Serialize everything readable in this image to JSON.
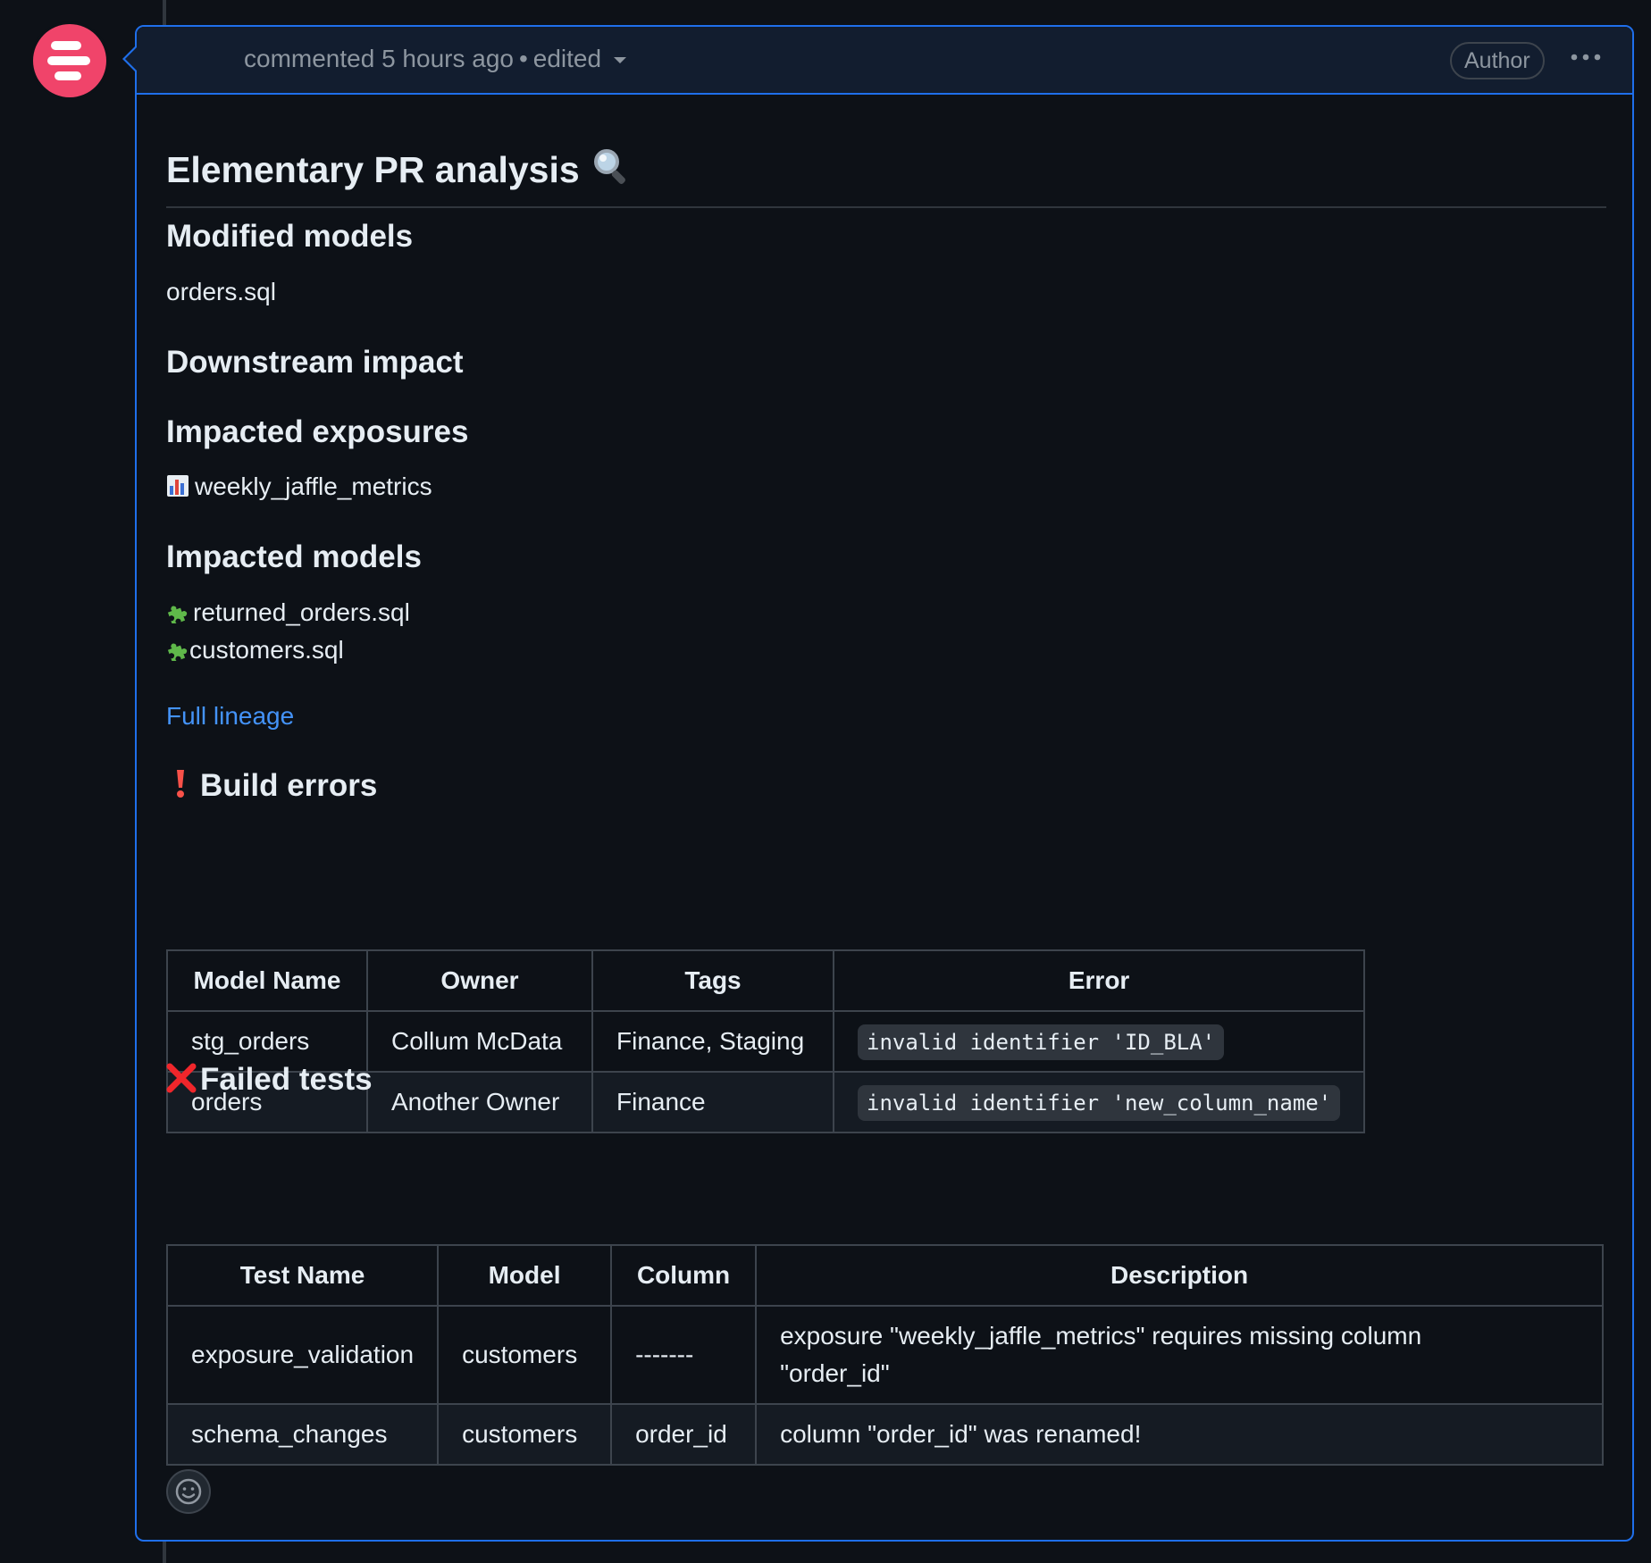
{
  "header": {
    "commented": "commented 5 hours ago",
    "edited": "edited",
    "author_badge": "Author"
  },
  "comment": {
    "title": "Elementary PR analysis",
    "modified_heading": "Modified models",
    "modified_file": "orders.sql",
    "downstream_heading": "Downstream impact",
    "exposures_heading": "Impacted exposures",
    "exposures": [
      "weekly_jaffle_metrics"
    ],
    "models_heading": "Impacted models",
    "impacted_models": [
      "returned_orders.sql",
      "customers.sql"
    ],
    "lineage_link": "Full lineage",
    "build_errors_heading": "Build errors",
    "build_errors": {
      "columns": [
        "Model Name",
        "Owner",
        "Tags",
        "Error"
      ],
      "rows": [
        [
          "stg_orders",
          "Collum McData",
          "Finance, Staging",
          "invalid identifier 'ID_BLA'"
        ],
        [
          "orders",
          "Another Owner",
          "Finance",
          "invalid identifier 'new_column_name'"
        ]
      ]
    },
    "failed_tests_heading": "Failed tests",
    "failed_tests": {
      "columns": [
        "Test Name",
        "Model",
        "Column",
        "Description"
      ],
      "rows": [
        [
          "exposure_validation",
          "customers",
          "-------",
          "exposure \"weekly_jaffle_metrics\" requires missing column",
          "\"order_id\""
        ],
        [
          "schema_changes",
          "customers",
          "order_id",
          "column \"order_id\" was renamed!"
        ]
      ]
    }
  },
  "icons": {
    "title_icon": "magnifier-icon",
    "exposure_icon": "bar-chart-icon",
    "model_icon": "puzzle-icon",
    "build_error_icon": "exclamation-icon",
    "failed_tests_icon": "cross-icon",
    "reaction_icon": "smiley-icon"
  },
  "colors": {
    "background": "#0d1117",
    "accent_border": "#1f6feb",
    "link": "#4493f8",
    "avatar": "#f0446a",
    "error_red": "#f85149"
  }
}
